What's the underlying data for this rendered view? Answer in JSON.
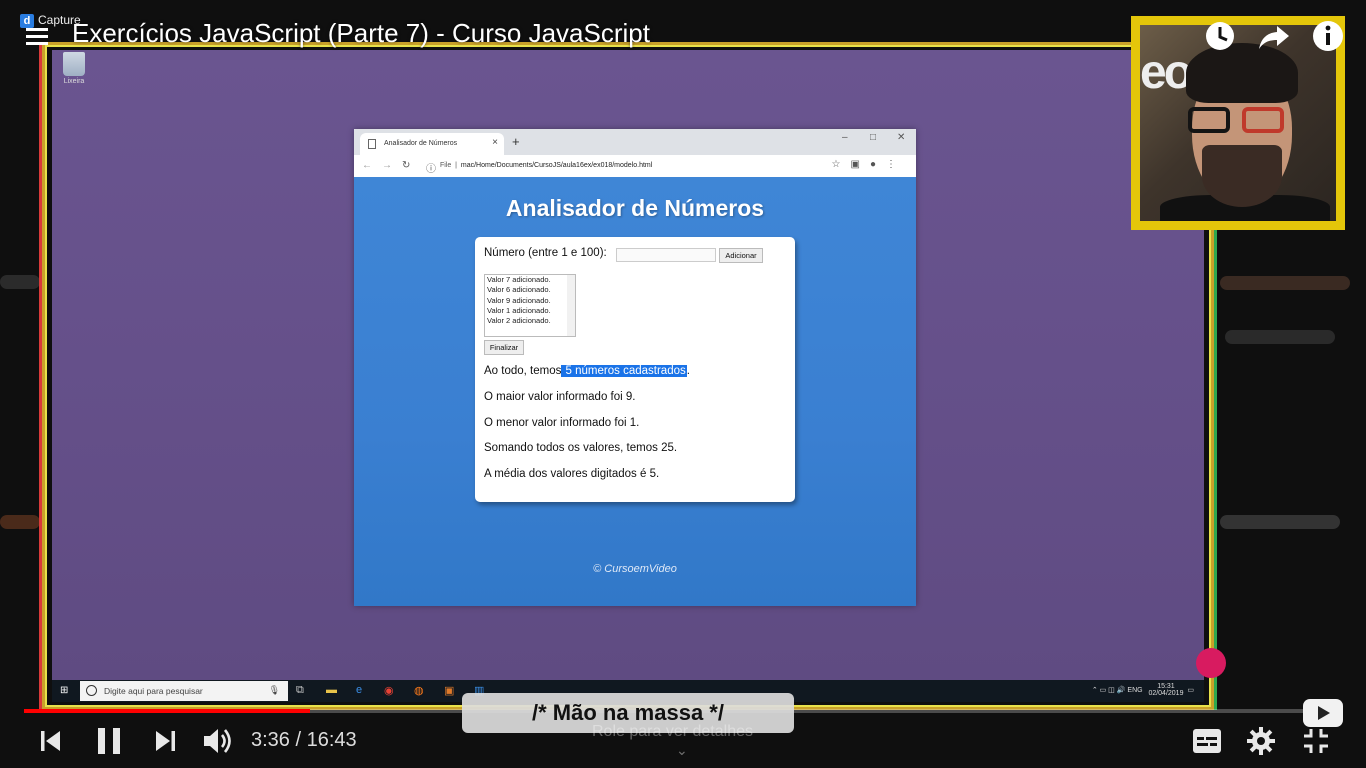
{
  "video": {
    "title": "Exercícios JavaScript (Parte 7) - Curso JavaScript",
    "capture_label": "Capture",
    "current_time": "3:36",
    "duration": "16:43",
    "progress_fraction": 0.217,
    "banner_text": "/* Mão na massa */",
    "details_hint": "Role para ver detalhes",
    "accent_color": "#ff0000",
    "icons": [
      "menu-icon",
      "clock-icon",
      "share-icon",
      "info-icon",
      "previous-icon",
      "pause-icon",
      "next-icon",
      "volume-icon",
      "subtitles-icon",
      "settings-icon",
      "exit-fullscreen-icon",
      "youtube-logo"
    ]
  },
  "webcam": {
    "sign_text": "eo"
  },
  "desktop": {
    "recycle_bin_label": "Lixeira"
  },
  "browser": {
    "tab_title": "Analisador de Números",
    "url_prefix": "File",
    "url": "mac/Home/Documents/CursoJS/aula16ex/ex018/modelo.html"
  },
  "app": {
    "heading": "Analisador de Números",
    "number_label": "Número (entre 1 e 100):",
    "add_button": "Adicionar",
    "list_items": [
      "Valor 7 adicionado.",
      "Valor 6 adicionado.",
      "Valor 9 adicionado.",
      "Valor 1 adicionado.",
      "Valor 2 adicionado."
    ],
    "finish_button": "Finalizar",
    "result_total_prefix": "Ao todo, temos",
    "result_total_highlight": " 5 números cadastrados",
    "result_total_suffix": ".",
    "result_max": "O maior valor informado foi 9.",
    "result_min": "O menor valor informado foi 1.",
    "result_sum": "Somando todos os valores, temos 25.",
    "result_avg": "A média dos valores digitados é 5.",
    "credits": "© CursoemVideo",
    "page_color": "#3a7fd1",
    "highlight_color": "#1a73e8"
  },
  "taskbar": {
    "search_placeholder": "Digite aqui para pesquisar",
    "language": "ENG",
    "time": "15:31",
    "date": "02/04/2019"
  }
}
